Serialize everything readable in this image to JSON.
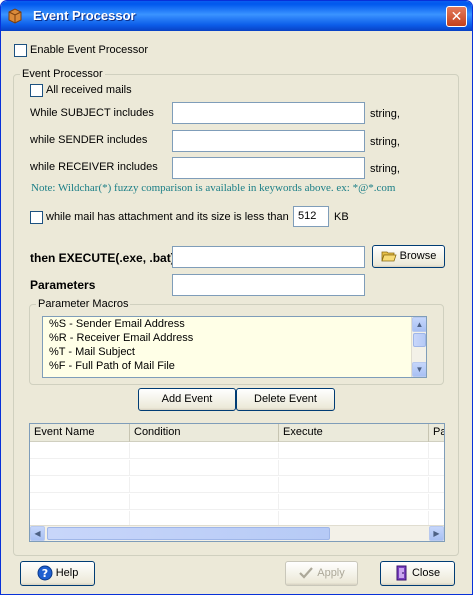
{
  "window": {
    "title": "Event Processor",
    "close_glyph": "✕"
  },
  "enable": {
    "label": "Enable Event Processor",
    "checked": false
  },
  "group": {
    "legend": "Event Processor",
    "all_mails": {
      "label": "All received mails",
      "checked": false
    },
    "subject": {
      "label": "While SUBJECT includes",
      "value": "",
      "suffix": "string,"
    },
    "sender": {
      "label": "while SENDER includes",
      "value": "",
      "suffix": "string,"
    },
    "receiver": {
      "label": "while RECEIVER includes",
      "value": "",
      "suffix": "string,"
    },
    "note": "Note: Wildchar(*) fuzzy comparison is available in keywords above. ex: *@*.com",
    "attachment": {
      "label": "while mail has attachment and its size is less than",
      "checked": false,
      "value": "512",
      "unit": "KB"
    },
    "execute": {
      "label": "then EXECUTE(.exe, .bat)",
      "value": ""
    },
    "browse_label": "Browse",
    "parameters": {
      "label": "Parameters",
      "value": ""
    },
    "macros": {
      "legend": "Parameter Macros",
      "items": [
        "%S  -  Sender Email Address",
        "%R  -  Receiver Email Address",
        "%T  -  Mail Subject",
        "%F  -  Full Path of Mail File"
      ]
    },
    "add_event_label": "Add Event",
    "delete_event_label": "Delete Event",
    "table": {
      "columns": [
        "Event Name",
        "Condition",
        "Execute",
        "Pa"
      ],
      "rows": []
    }
  },
  "footer": {
    "help_label": "Help",
    "apply_label": "Apply",
    "apply_enabled": false,
    "close_label": "Close"
  },
  "icons": {
    "app": "app-package-icon",
    "browse": "folder-open-icon",
    "help": "question-mark-icon",
    "apply": "checkmark-icon",
    "close": "door-exit-icon"
  },
  "colors": {
    "title_bar": "#0058ee",
    "note_text": "#1a7e86",
    "macro_background": "#ffffe7",
    "window_face": "#ece9d8"
  }
}
